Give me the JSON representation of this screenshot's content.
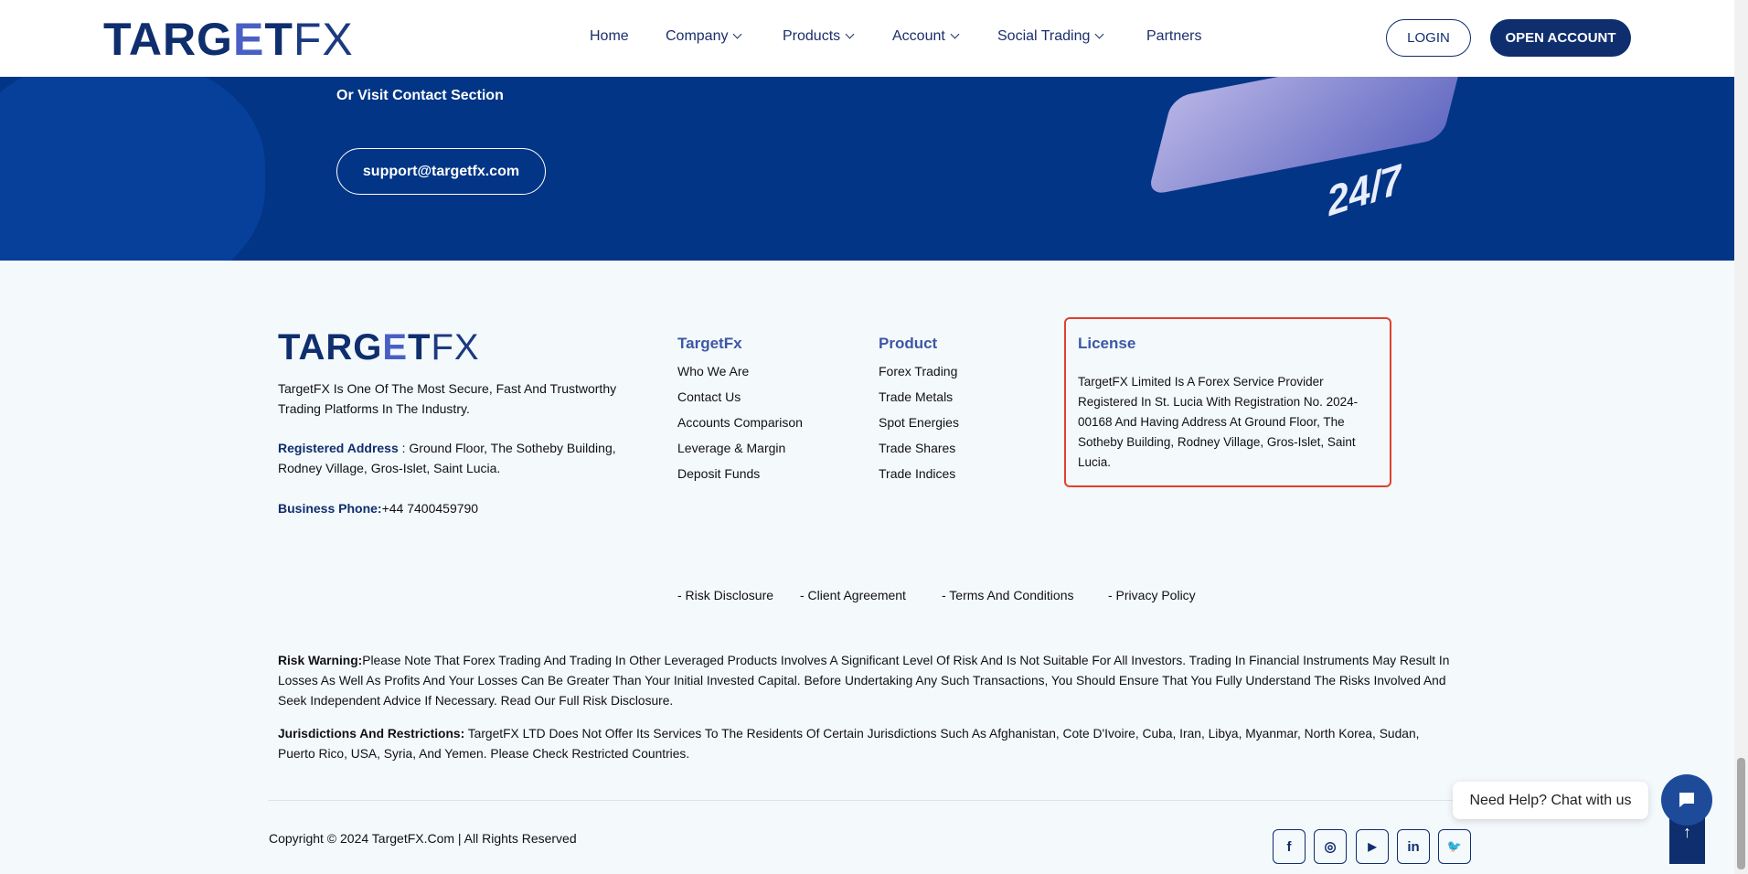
{
  "header": {
    "logo": {
      "main": "TARG",
      "g": "E",
      "main2": "T",
      "fx": "FX"
    },
    "nav": [
      {
        "label": "Home"
      },
      {
        "label": "Company"
      },
      {
        "label": "Products"
      },
      {
        "label": "Account"
      },
      {
        "label": "Social Trading"
      },
      {
        "label": "Partners"
      }
    ],
    "login": "LOGIN",
    "open_account": "OPEN ACCOUNT"
  },
  "contact": {
    "visit_text": "Or Visit Contact Section",
    "email": "support@targetfx.com",
    "badge": "24/7"
  },
  "footer": {
    "description": "TargetFX Is One Of The Most Secure, Fast And Trustworthy Trading Platforms In The Industry.",
    "address_label": "Registered Address",
    "address": " : Ground Floor, The Sotheby Building, Rodney Village, Gros-Islet, Saint Lucia.",
    "phone_label": "Business Phone:",
    "phone": "+44 7400459790",
    "targetfx_col": {
      "heading": "TargetFx",
      "items": [
        "Who We Are",
        "Contact Us",
        "Accounts Comparison",
        "Leverage & Margin",
        "Deposit Funds"
      ]
    },
    "product_col": {
      "heading": "Product",
      "items": [
        "Forex Trading",
        "Trade Metals",
        "Spot Energies",
        "Trade Shares",
        "Trade Indices"
      ]
    },
    "license": {
      "heading": "License",
      "text": "TargetFX Limited Is A Forex Service Provider Registered In St. Lucia With Registration No. 2024-00168 And Having Address At Ground Floor, The Sotheby Building, Rodney Village, Gros-Islet, Saint Lucia."
    },
    "legal_links": [
      "- Risk Disclosure",
      "- Client Agreement",
      "- Terms And Conditions",
      "- Privacy Policy"
    ],
    "risk_label": "Risk Warning:",
    "risk_text": "Please Note That Forex Trading And Trading In Other Leveraged Products Involves A Significant Level Of Risk And Is Not Suitable For All Investors. Trading In Financial Instruments May Result In Losses As Well As Profits And Your Losses Can Be Greater Than Your Initial Invested Capital. Before Undertaking Any Such Transactions, You Should Ensure That You Fully Understand The Risks Involved And Seek Independent Advice If Necessary. Read Our Full Risk Disclosure.",
    "juris_label": "Jurisdictions And Restrictions:",
    "juris_text": " TargetFX LTD Does Not Offer Its Services To The Residents Of Certain Jurisdictions Such As Afghanistan, Cote D'Ivoire, Cuba, Iran, Libya, Myanmar, North Korea, Sudan, Puerto Rico, USA, Syria, And Yemen. Please Check Restricted Countries.",
    "copyright": "Copyright © 2024 TargetFX.Com | All Rights Reserved",
    "social": [
      {
        "icon": "facebook-icon",
        "glyph": "f"
      },
      {
        "icon": "instagram-icon",
        "glyph": "◎"
      },
      {
        "icon": "youtube-icon",
        "glyph": "▶"
      },
      {
        "icon": "linkedin-icon",
        "glyph": "in"
      },
      {
        "icon": "twitter-icon",
        "glyph": "🐦"
      }
    ]
  },
  "chat": {
    "label": "Need Help? Chat with us"
  },
  "colors": {
    "brand": "#0f2e6e",
    "band": "#023586",
    "highlight": "#e0402e"
  }
}
